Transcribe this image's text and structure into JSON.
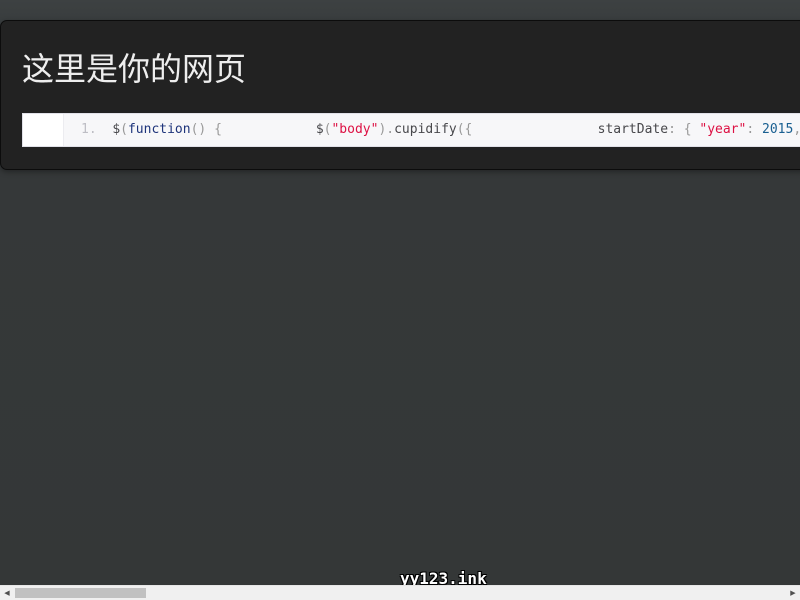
{
  "page": {
    "title": "这里是你的网页"
  },
  "code": {
    "line_number": "1.",
    "tokens": {
      "t1": "$",
      "t2": "(",
      "t3": "function",
      "t4": "() {",
      "t5": "            $",
      "t6": "(",
      "t7": "\"body\"",
      "t8": ").",
      "t9": "cupidify",
      "t10": "({",
      "t11": "                startDate",
      "t12": ": {",
      "t13": "\"year\"",
      "t14": ":",
      "t15": "2015",
      "t16": ","
    }
  },
  "watermark": {
    "text": "yy123.ink"
  },
  "scrollbar": {
    "left_arrow": "◀",
    "right_arrow": "▶"
  },
  "colors": {
    "page_background": "#363a3b",
    "panel_background": "#222222",
    "code_background": "#f7f7f9",
    "string_color": "#dd1144",
    "keyword_color": "#1e347b",
    "number_color": "#195f91"
  }
}
